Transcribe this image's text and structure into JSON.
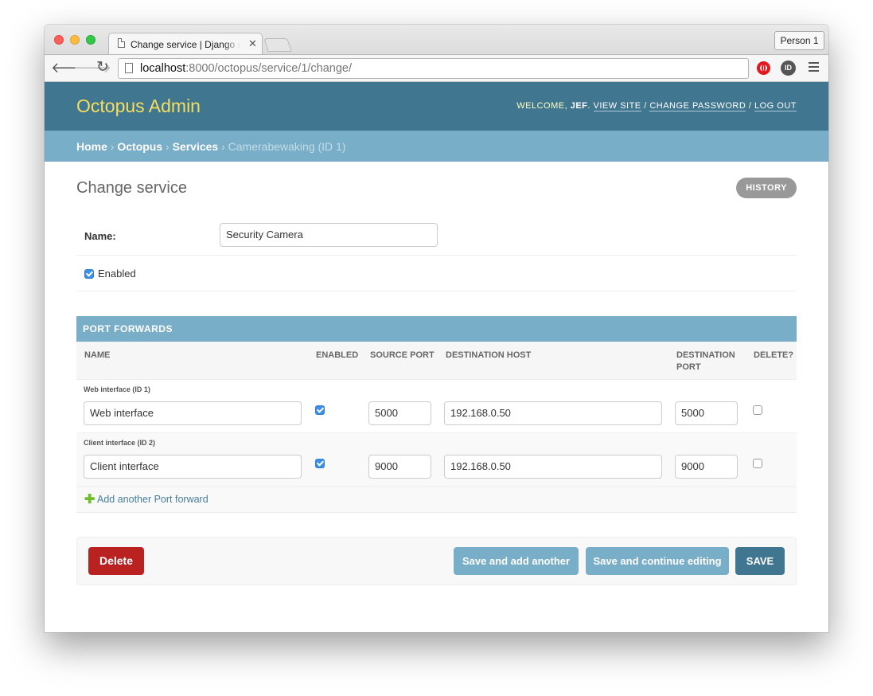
{
  "browser": {
    "tab_title": "Change service | Django site admin",
    "close_glyph": "✕",
    "profile": "Person 1",
    "url_host": "localhost",
    "url_path": ":8000/octopus/service/1/change/",
    "back_glyph": "🡐",
    "forward_glyph": "🡒",
    "reload_glyph": "↻",
    "ext_label": "ID"
  },
  "header": {
    "branding": "Octopus Admin",
    "welcome": "Welcome, ",
    "user": "JEF",
    "view_site": "View site",
    "change_password": "Change password",
    "log_out": "Log out",
    "sep": " / "
  },
  "breadcrumbs": {
    "home": "Home",
    "app": "Octopus",
    "model": "Services",
    "current": "Camerabewaking (ID 1)",
    "sep": " › "
  },
  "form": {
    "title": "Change service",
    "history": "History",
    "name_label": "Name:",
    "name_value": "Security Camera",
    "enabled_label": "Enabled",
    "enabled": true
  },
  "inline": {
    "caption": "Port forwards",
    "headers": {
      "name": "Name",
      "enabled": "Enabled",
      "source_port": "Source port",
      "destination_host": "Destination host",
      "destination_port_1": "Destination",
      "destination_port_2": "port",
      "delete": "Delete?"
    },
    "rows": [
      {
        "label": "Web interface (ID 1)",
        "name": "Web interface",
        "enabled": true,
        "source_port": "5000",
        "destination_host": "192.168.0.50",
        "destination_port": "5000",
        "delete": false
      },
      {
        "label": "Client interface (ID 2)",
        "name": "Client interface",
        "enabled": true,
        "source_port": "9000",
        "destination_host": "192.168.0.50",
        "destination_port": "9000",
        "delete": false
      }
    ],
    "add_icon": "✚",
    "add_link": "Add another Port forward"
  },
  "submit": {
    "delete": "Delete",
    "save_add_another": "Save and add another",
    "save_continue": "Save and continue editing",
    "save": "SAVE"
  },
  "colors": {
    "header_bg": "#417690",
    "breadcrumb_bg": "#79aec8",
    "branding": "#f5dd5d",
    "delete_bg": "#ba2121"
  }
}
